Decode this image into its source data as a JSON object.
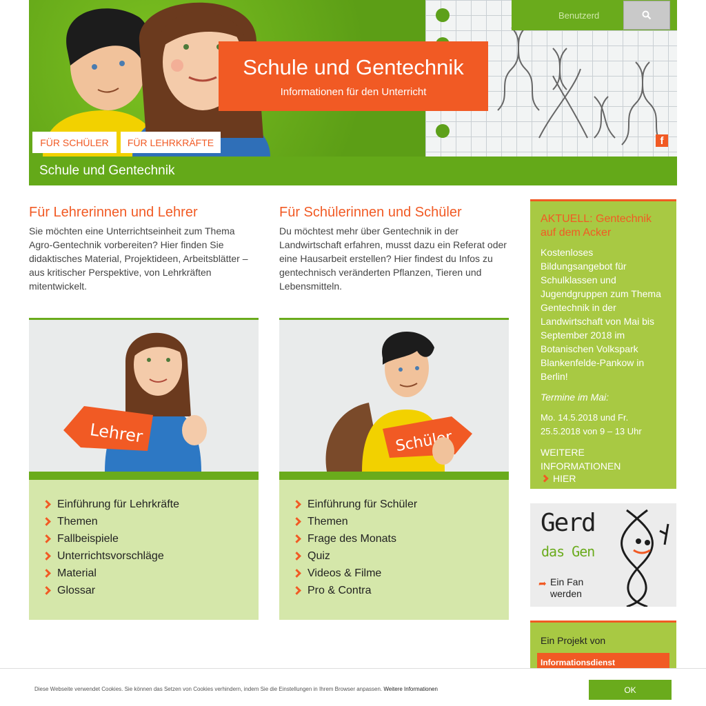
{
  "header": {
    "title": "Schule und Gentechnik",
    "subtitle": "Informationen für den Unterricht",
    "search_placeholder": "Benutzerd",
    "btn_schueler": "FÜR SCHÜLER",
    "btn_lehrkraefte": "FÜR LEHRKRÄFTE",
    "facebook_icon": "facebook-icon",
    "search_icon": "search-icon"
  },
  "greenbar": {
    "label": "Schule und Gentechnik"
  },
  "teachers": {
    "heading": "Für Lehrerinnen und Lehrer",
    "intro": "Sie möchten eine Unterrichtseinheit zum Thema Agro-Gentechnik vorbereiten? Hier finden Sie didaktisches Material, Projektideen, Arbeitsblätter – aus kritischer Perspektive, von Lehrkräften mitentwickelt.",
    "sign": "Lehrer",
    "links": [
      "Einführung für Lehrkräfte",
      "Themen",
      "Fallbeispiele",
      "Unterrichtsvorschläge",
      "Material",
      "Glossar"
    ]
  },
  "students": {
    "heading": "Für Schülerinnen und Schüler",
    "intro": "Du möchtest mehr über Gentechnik in der Landwirtschaft erfahren, musst dazu ein Referat oder eine Hausarbeit erstellen? Hier findest du Infos zu gentechnisch veränderten Pflanzen, Tieren und Lebensmitteln.",
    "sign": "Schüler",
    "links": [
      "Einführung für Schüler",
      "Themen",
      "Frage des Monats",
      "Quiz",
      "Videos & Filme",
      "Pro & Contra"
    ]
  },
  "sidebar": {
    "news_title": "AKTUELL: Gentechnik auf dem Acker",
    "news_text": "Kostenloses Bildungsangebot für Schulklassen und Jugendgruppen zum Thema Gentechnik in der Landwirtschaft von Mai bis September 2018 im Botanischen Volkspark Blankenfelde-Pankow in Berlin!",
    "news_sub": "Termine im Mai:",
    "news_dates": "Mo. 14.5.2018 und Fr. 25.5.2018 von 9 – 13 Uhr",
    "news_more": "WEITERE INFORMATIONEN",
    "news_here": "HIER",
    "gerd_title": "Gerd",
    "gerd_sub": "das Gen",
    "gerd_fan": "Ein Fan werden",
    "projekt_label": "Ein Projekt von",
    "projekt_org": "Informationsdienst"
  },
  "cookie": {
    "text": "Diese Webseite verwendet Cookies. Sie können das Setzen von Cookies verhindern, indem Sie die Einstellungen in Ihrem Browser anpassen.",
    "link": "Weitere Informationen",
    "ok": "OK"
  },
  "colors": {
    "accent": "#f15a24",
    "green": "#6aab1c",
    "light_green": "#d5e7aa",
    "side_green": "#a8c943"
  }
}
